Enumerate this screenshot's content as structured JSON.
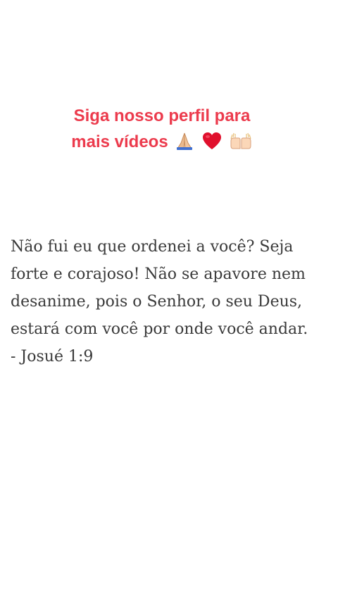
{
  "promo": {
    "line1": "Siga nosso perfil para",
    "line2": "mais vídeos",
    "icons": [
      "praying-hands-icon",
      "red-heart-icon",
      "raised-hands-icon"
    ],
    "color": "#ec3b4d"
  },
  "verse": {
    "lines": [
      "Não fui eu que ordenei a você? Seja",
      "forte e corajoso! Não se apavore nem",
      "desanime, pois o Senhor, o seu Deus,",
      "estará com você por onde você andar.",
      "- Josué 1:9"
    ],
    "color": "#3a3a3a"
  }
}
